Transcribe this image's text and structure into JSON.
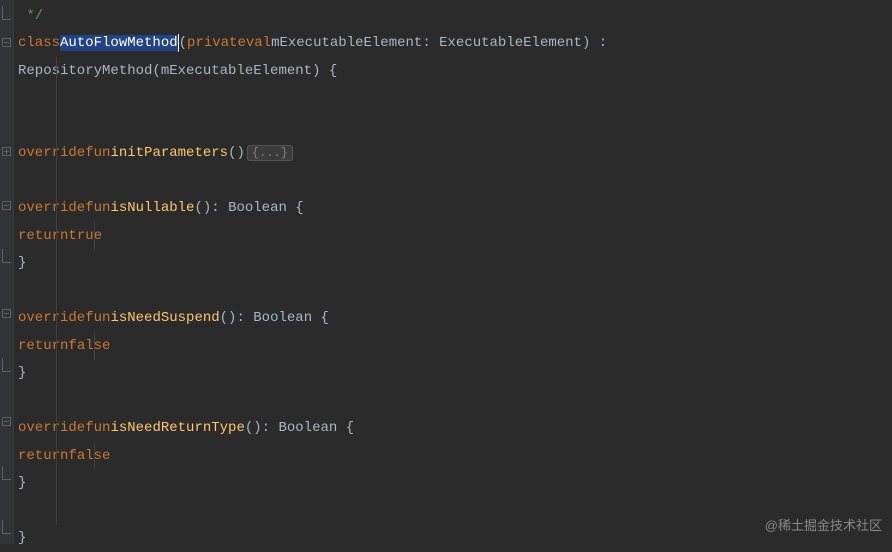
{
  "comment_close": " */",
  "class_decl": {
    "keyword_class": "class",
    "name": "AutoFlowMethod",
    "keyword_private": "private",
    "keyword_val": "val",
    "param_name": "mExecutableElement",
    "param_type": "ExecutableElement"
  },
  "extends": {
    "parent": "RepositoryMethod",
    "arg": "mExecutableElement"
  },
  "func1": {
    "override": "override",
    "fun": "fun",
    "name": "initParameters",
    "folded": "{...}"
  },
  "func2": {
    "override": "override",
    "fun": "fun",
    "name": "isNullable",
    "return_type": "Boolean",
    "return_kw": "return",
    "return_val": "true"
  },
  "func3": {
    "override": "override",
    "fun": "fun",
    "name": "isNeedSuspend",
    "return_type": "Boolean",
    "return_kw": "return",
    "return_val": "false"
  },
  "func4": {
    "override": "override",
    "fun": "fun",
    "name": "isNeedReturnType",
    "return_type": "Boolean",
    "return_kw": "return",
    "return_val": "false"
  },
  "watermark": "@稀土掘金技术社区"
}
